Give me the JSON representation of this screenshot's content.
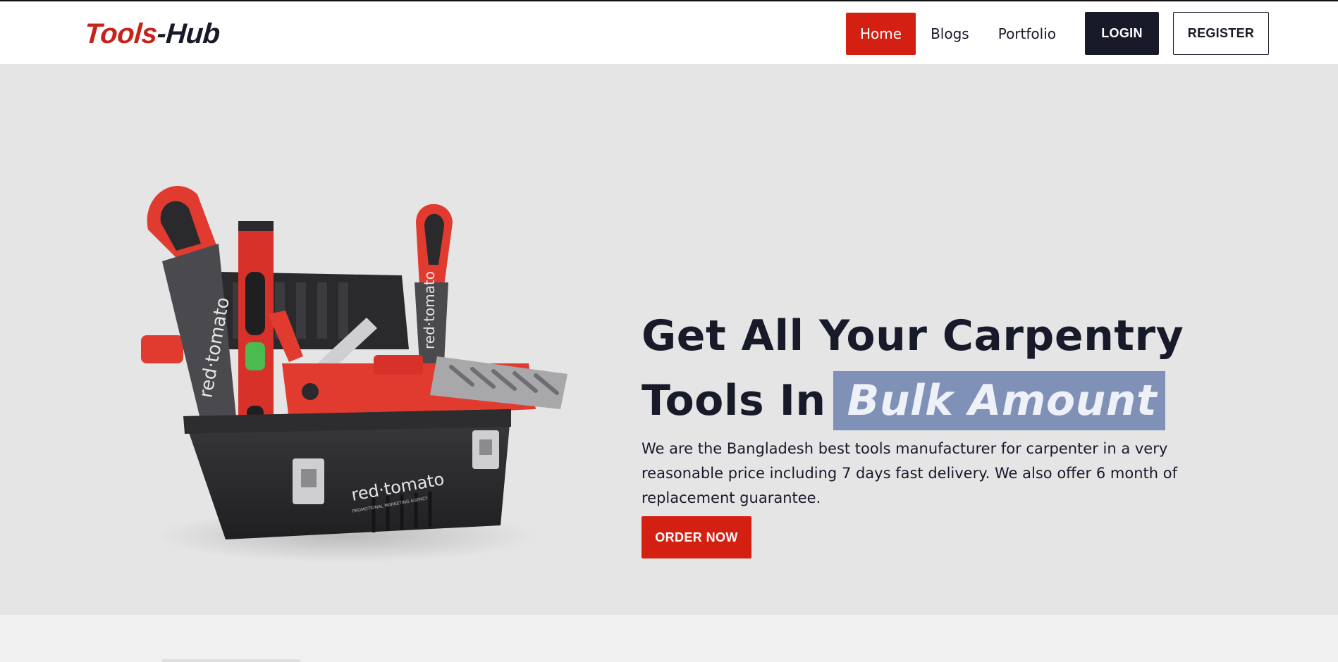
{
  "nav": {
    "logo": {
      "part1": "Tools",
      "part2": "-Hub"
    },
    "links": [
      {
        "label": "Home",
        "active": true
      },
      {
        "label": "Blogs",
        "active": false
      },
      {
        "label": "Portfolio",
        "active": false
      }
    ],
    "login_label": "LOGIN",
    "register_label": "REGISTER"
  },
  "hero": {
    "title_line1": "Get All Your Carpentry",
    "title_line2_prefix": "Tools In",
    "title_highlight": "Bulk Amount",
    "description": "We are the Bangladesh best tools manufacturer for carpenter in a very reasonable price including 7 days fast delivery. We also offer 6 month of replacement guarantee.",
    "order_label": "ORDER NOW",
    "illustration": {
      "brand_text": "red·tomato",
      "brand_sub": "PROMOTIONAL MARKETING AGENCY"
    }
  },
  "colors": {
    "brand_red": "#d42012",
    "dark": "#181a2a",
    "hero_bg": "#e5e5e6",
    "highlight_bg": "#7f91b7"
  }
}
